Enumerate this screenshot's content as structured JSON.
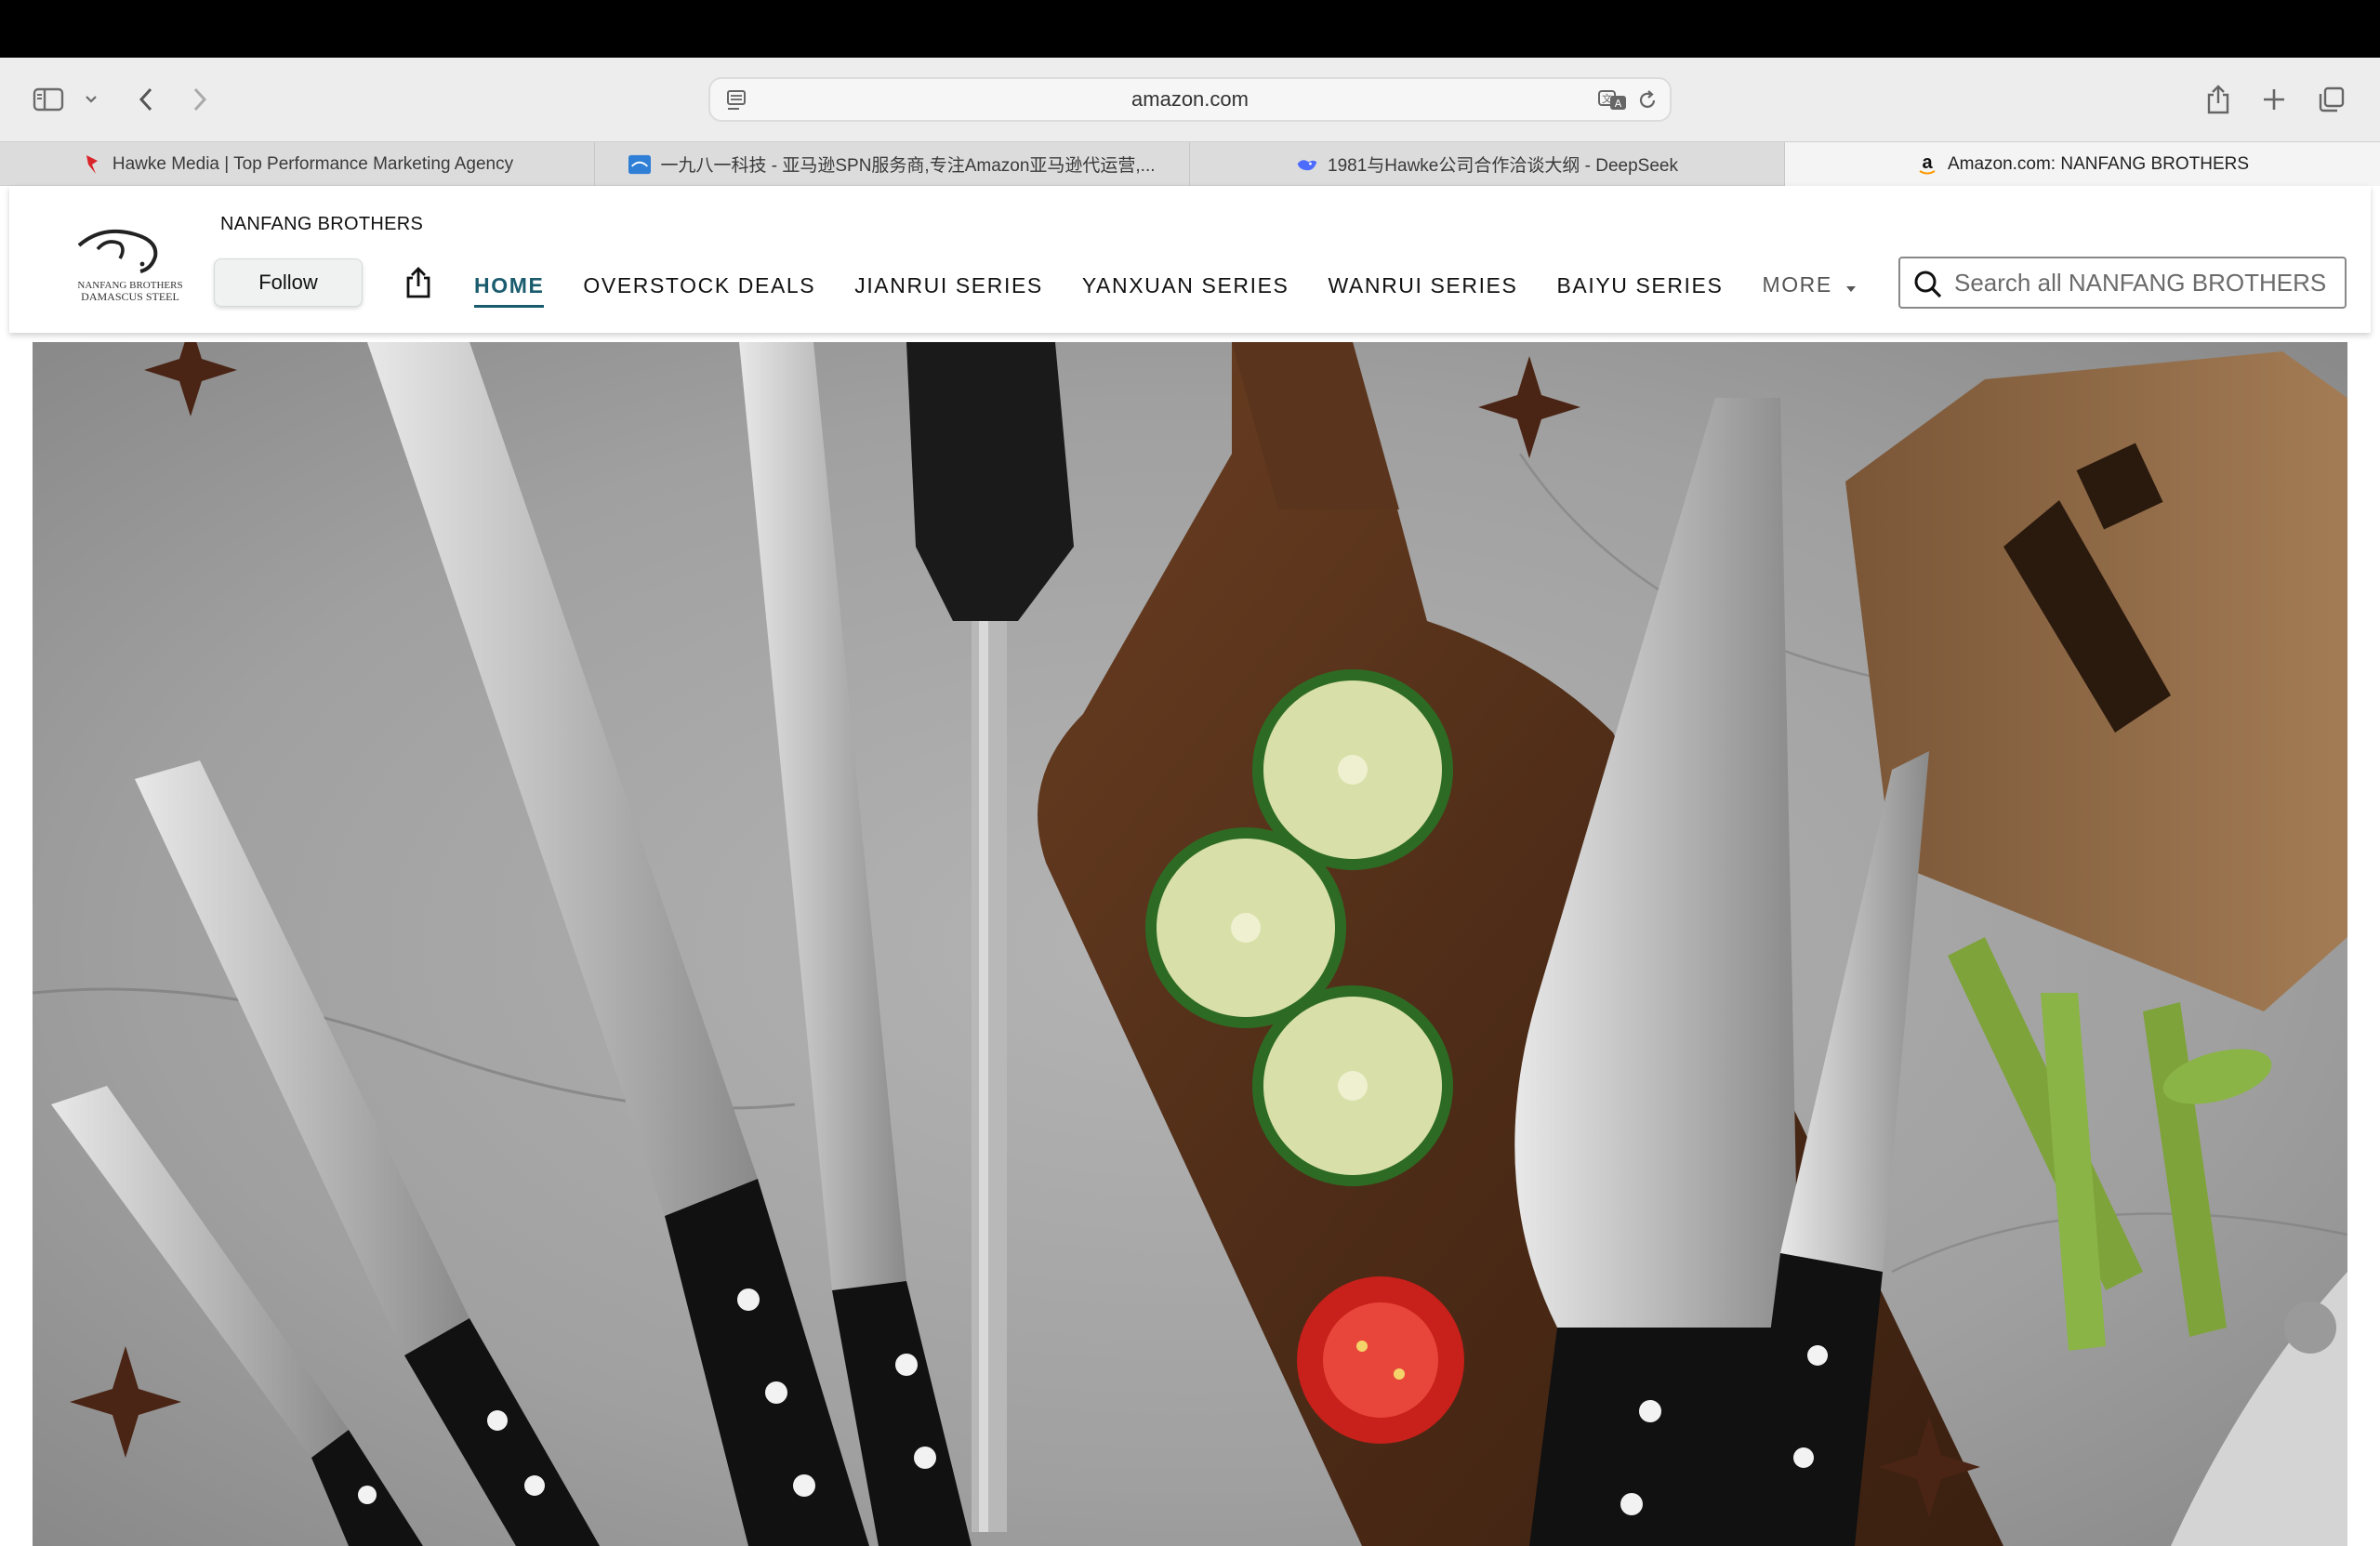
{
  "browser": {
    "url": "amazon.com",
    "tabs": [
      {
        "label": "Hawke Media | Top Performance Marketing Agency",
        "active": false
      },
      {
        "label": "一九八一科技 - 亚马逊SPN服务商,专注Amazon亚马逊代运营,...",
        "active": false
      },
      {
        "label": "1981与Hawke公司合作洽谈大纲 - DeepSeek",
        "active": false
      },
      {
        "label": "Amazon.com: NANFANG BROTHERS",
        "active": true
      }
    ]
  },
  "store": {
    "brand_name": "NANFANG BROTHERS",
    "logo_line1": "NANFANG BROTHERS",
    "logo_line2": "DAMASCUS STEEL",
    "follow_label": "Follow",
    "nav": [
      {
        "label": "HOME",
        "active": true
      },
      {
        "label": "OVERSTOCK DEALS",
        "active": false
      },
      {
        "label": "JIANRUI SERIES",
        "active": false
      },
      {
        "label": "YANXUAN SERIES",
        "active": false
      },
      {
        "label": "WANRUI SERIES",
        "active": false
      },
      {
        "label": "BAIYU SERIES",
        "active": false
      }
    ],
    "more_label": "MORE",
    "search_placeholder": "Search all NANFANG BROTHERS"
  },
  "colors": {
    "accent": "#1a5c6e",
    "toolbar_bg": "#ededed",
    "tabbar_bg": "#dcdcdc"
  },
  "icons": [
    "sidebar-icon",
    "chevron-down-icon",
    "back-icon",
    "forward-icon",
    "reader-icon",
    "translate-icon",
    "reload-icon",
    "share-icon",
    "new-tab-icon",
    "tab-overview-icon",
    "search-icon"
  ]
}
